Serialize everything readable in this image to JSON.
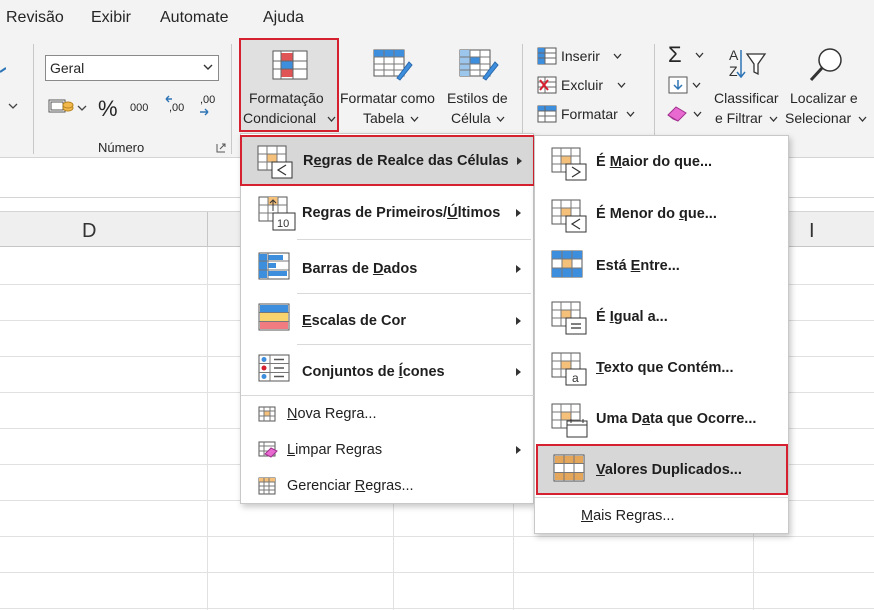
{
  "menubar": {
    "tabs": [
      "Revisão",
      "Exibir",
      "Automate",
      "Ajuda"
    ]
  },
  "ribbon": {
    "number_format_value": "Geral",
    "number_group_label": "Número",
    "percent_symbol": "%",
    "thousands_label": "000",
    "dec_increase_label": ",00",
    "dec_decrease_label": ",00",
    "cond_format_line1": "Formatação",
    "cond_format_line2": "Condicional",
    "format_table_line1": "Formatar como",
    "format_table_line2": "Tabela",
    "cell_styles_line1": "Estilos de",
    "cell_styles_line2": "Célula",
    "insert_label": "Inserir",
    "delete_label": "Excluir",
    "format_label": "Formatar",
    "sort_line1": "Classificar",
    "sort_line2": "e Filtrar",
    "find_line1": "Localizar e",
    "find_line2": "Selecionar"
  },
  "sheet": {
    "columns": [
      "D",
      "I"
    ]
  },
  "cond_menu": {
    "items": [
      {
        "pre": "R",
        "u": "e",
        "post": "gras de Realce das Células"
      },
      {
        "pre": "Regras de Primeiros/",
        "u": "Ú",
        "post": "ltimos"
      },
      {
        "pre": "Barras de ",
        "u": "D",
        "post": "ados"
      },
      {
        "pre": "",
        "u": "E",
        "post": "scalas de Cor"
      },
      {
        "pre": "Conjuntos de ",
        "u": "Í",
        "post": "cones"
      },
      {
        "pre": "",
        "u": "N",
        "post": "ova Regra..."
      },
      {
        "pre": "",
        "u": "L",
        "post": "impar Regras"
      },
      {
        "pre": "Gerenciar ",
        "u": "R",
        "post": "egras..."
      }
    ]
  },
  "highlight_menu": {
    "items": [
      {
        "pre": "É ",
        "u": "M",
        "post": "aior do que..."
      },
      {
        "pre": "É Menor do ",
        "u": "q",
        "post": "ue..."
      },
      {
        "pre": "Está ",
        "u": "E",
        "post": "ntre..."
      },
      {
        "pre": "É ",
        "u": "I",
        "post": "gual a..."
      },
      {
        "pre": "",
        "u": "T",
        "post": "exto que Contém..."
      },
      {
        "pre": "Uma D",
        "u": "a",
        "post": "ta que Ocorre..."
      },
      {
        "pre": "",
        "u": "V",
        "post": "alores Duplicados..."
      },
      {
        "pre": "",
        "u": "M",
        "post": "ais Regras..."
      }
    ]
  },
  "colors": {
    "highlight_border": "#d5212f",
    "highlight_bg": "#d7d7d7"
  }
}
